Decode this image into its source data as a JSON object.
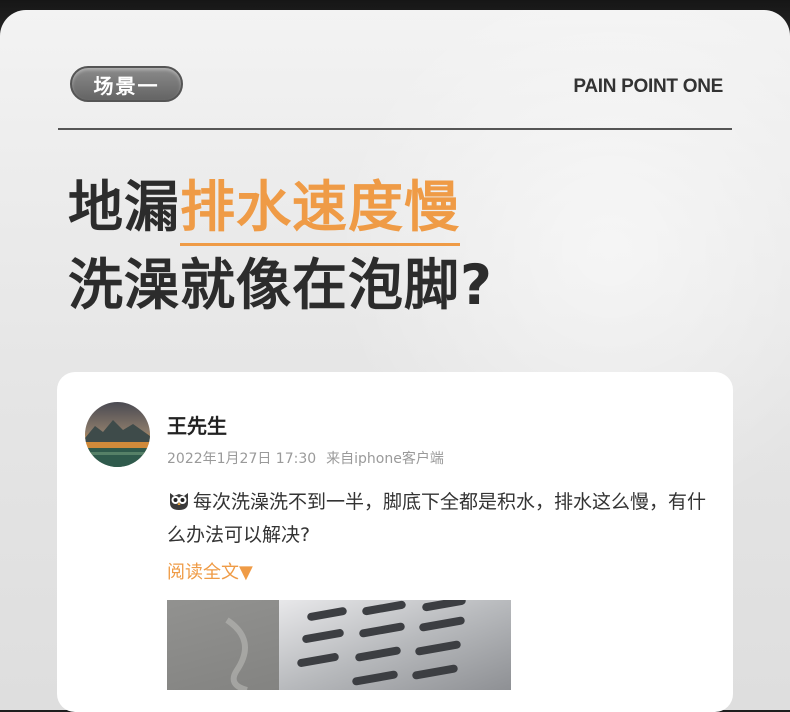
{
  "header": {
    "scene_tag": "场景一",
    "pain_point_label": "PAIN POINT ONE"
  },
  "headline": {
    "line1_prefix": "地漏",
    "line1_highlight": "排水速度慢",
    "line2": "洗澡就像在泡脚?"
  },
  "post": {
    "username": "王先生",
    "date": "2022年1月27日 17:30",
    "source": "来自iphone客户端",
    "body": "每次洗澡洗不到一半，脚底下全都是积水，排水这么慢，有什么办法可以解决?",
    "emoji_icon": "owl-emoji-icon",
    "read_more": "阅读全文▼"
  },
  "colors": {
    "accent": "#ef9b46",
    "headline": "#2c2c2c",
    "pill": "#6f6f6f"
  }
}
